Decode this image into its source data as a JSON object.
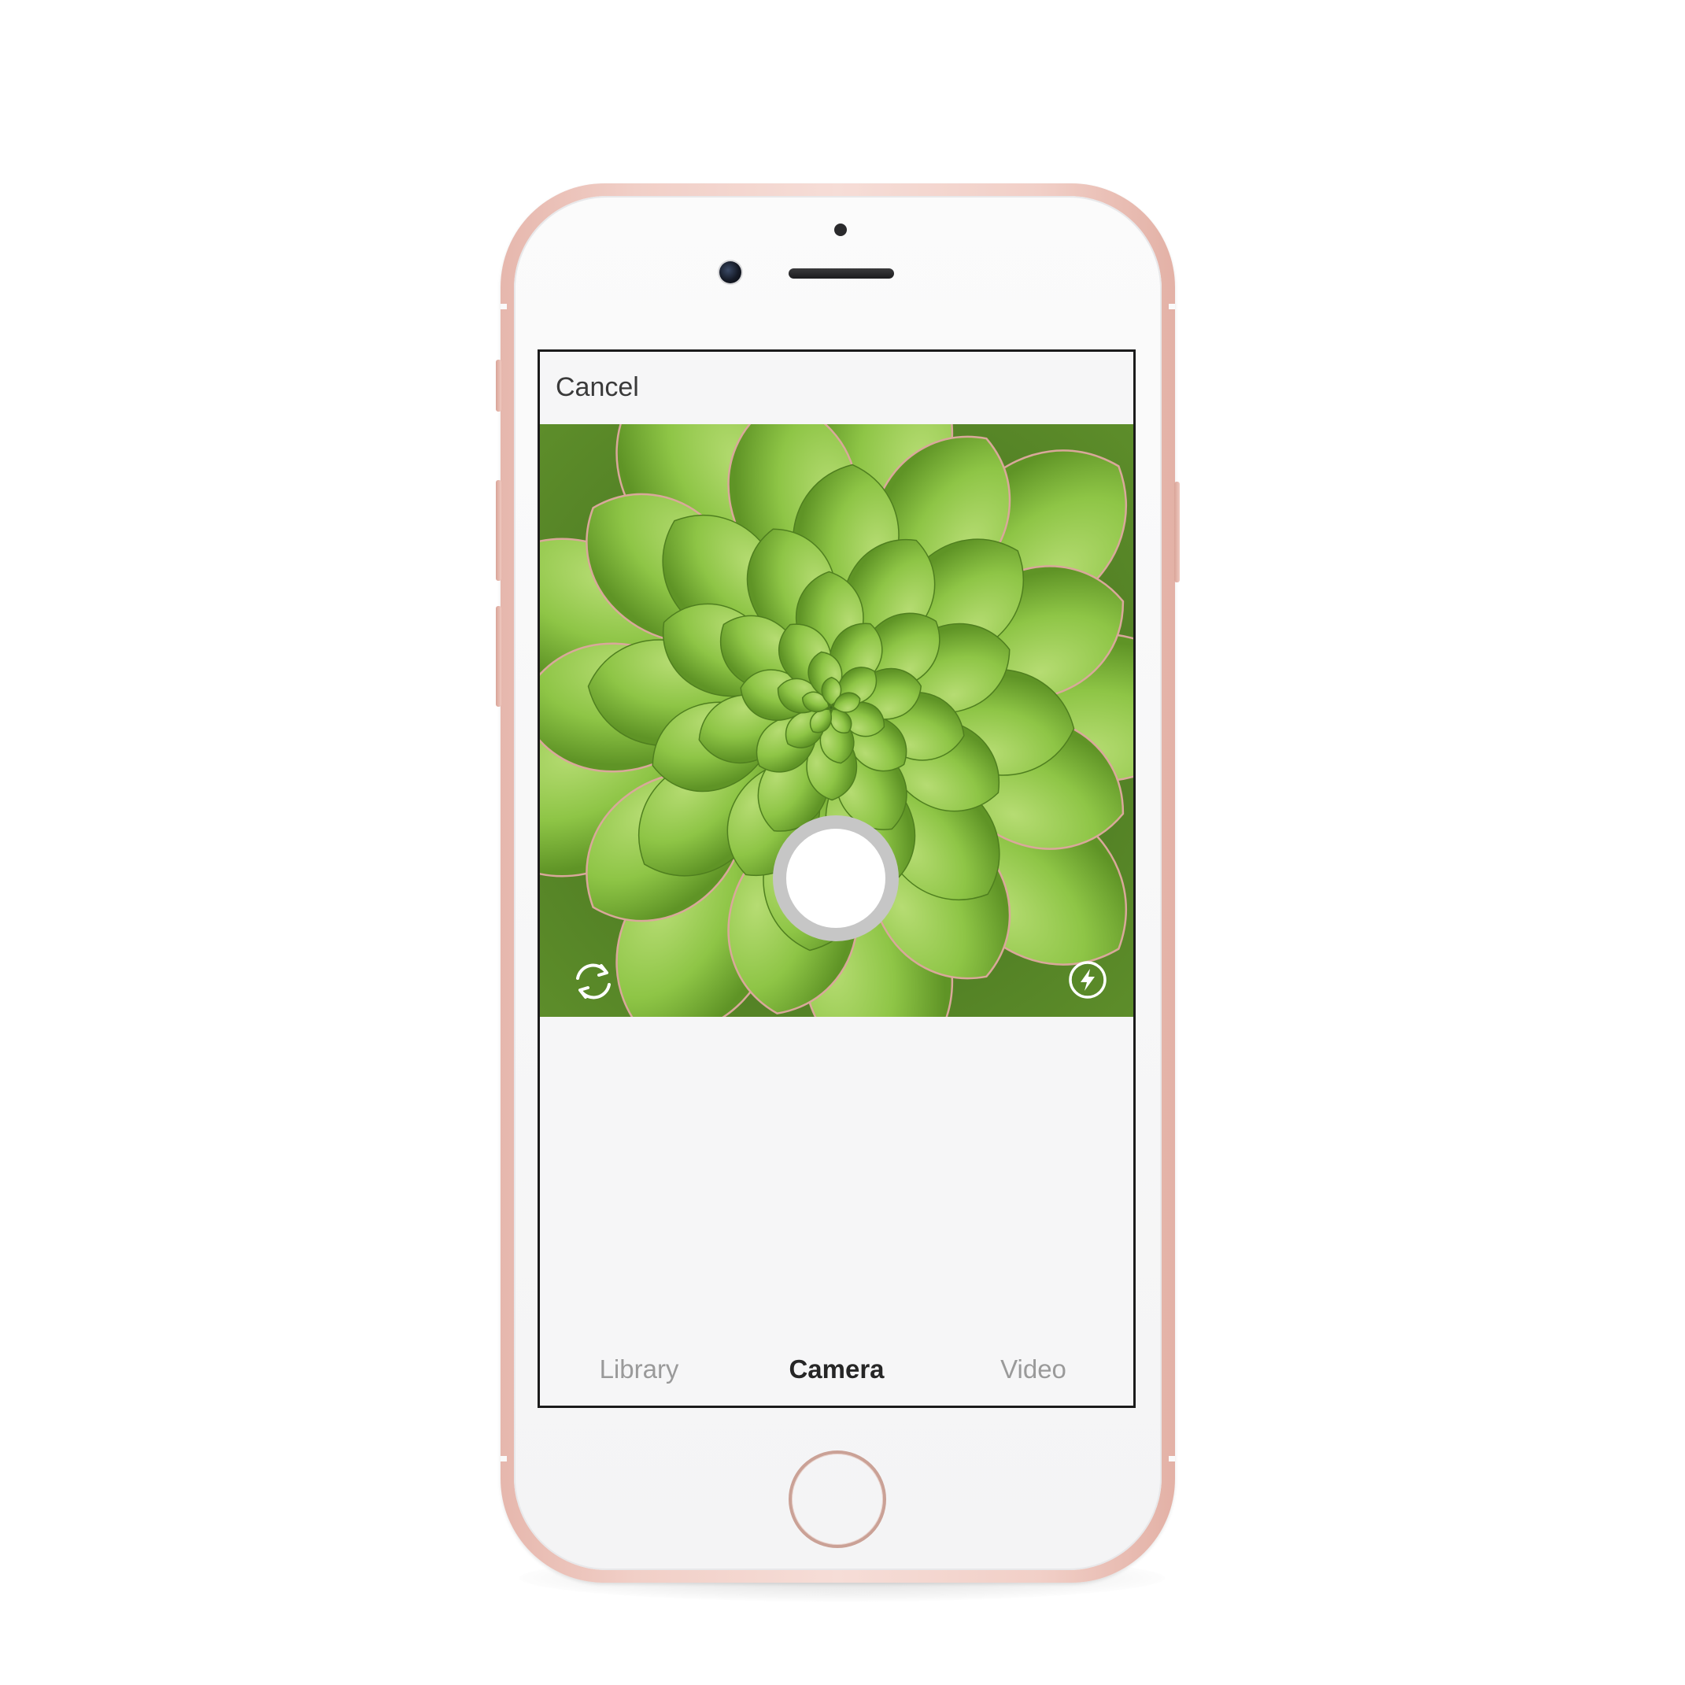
{
  "nav": {
    "cancel_label": "Cancel"
  },
  "viewfinder": {
    "subject": "succulent rosette",
    "left_control_icon": "rotate-camera-icon",
    "right_control_icon": "flash-icon"
  },
  "capture": {
    "shutter_icon": "shutter-button"
  },
  "tabs": [
    {
      "label": "Library",
      "state": "inactive"
    },
    {
      "label": "Camera",
      "state": "active"
    },
    {
      "label": "Video",
      "state": "inactive"
    }
  ],
  "colors": {
    "phone_body": "#f1cfc7",
    "leaf_green": "#8fc24a",
    "active_tab": "#262626",
    "inactive_tab": "#9a9a9a",
    "shutter_ring": "#c6c6c6"
  }
}
